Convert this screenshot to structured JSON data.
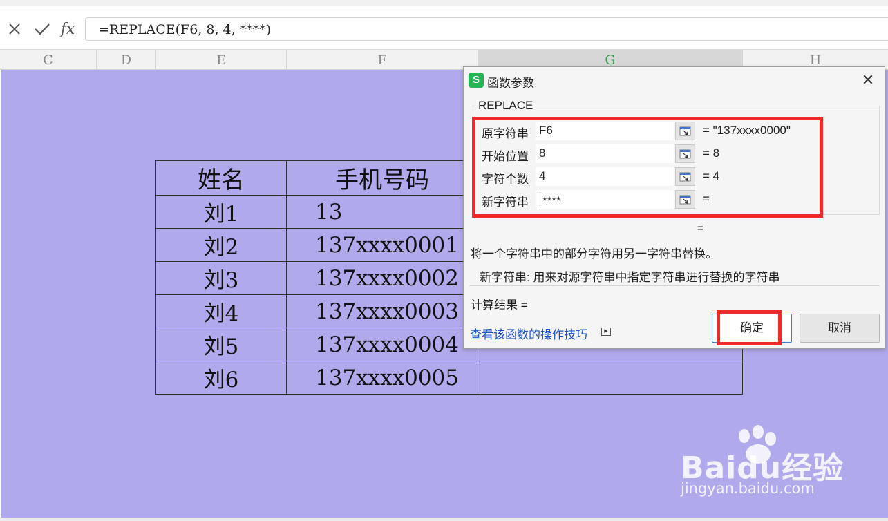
{
  "formula_bar": {
    "formula": "=REPLACE(F6, 8, 4, ****)",
    "cancel_icon": "close-icon",
    "confirm_icon": "check-icon",
    "fx_label": "fx"
  },
  "columns": [
    "C",
    "D",
    "E",
    "F",
    "G",
    "H"
  ],
  "selected_column": "G",
  "table": {
    "headers": [
      "姓名",
      "手机号码",
      ""
    ],
    "rows": [
      {
        "name": "刘1",
        "phone": "13",
        "result": ""
      },
      {
        "name": "刘2",
        "phone": "137xxxx0001",
        "result": ""
      },
      {
        "name": "刘3",
        "phone": "137xxxx0002",
        "result": ""
      },
      {
        "name": "刘4",
        "phone": "137xxxx0003",
        "result": ""
      },
      {
        "name": "刘5",
        "phone": "137xxxx0004",
        "result": ""
      },
      {
        "name": "刘6",
        "phone": "137xxxx0005",
        "result": ""
      }
    ]
  },
  "dialog": {
    "icon_letter": "S",
    "title": "函数参数",
    "function_name": "REPLACE",
    "args": [
      {
        "label": "原字符串",
        "value": "F6",
        "result": "= \"137xxxx0000\""
      },
      {
        "label": "开始位置",
        "value": "8",
        "result": "= 8"
      },
      {
        "label": "字符个数",
        "value": "4",
        "result": "= 4"
      },
      {
        "label": "新字符串",
        "value": "****",
        "result": "="
      }
    ],
    "formula_result_eq": "=",
    "description": "将一个字符串中的部分字符用另一字符串替换。",
    "arg_description": "新字符串:  用来对源字符串中指定字符串进行替换的字符串",
    "calc_result": "计算结果 =",
    "help_link": "查看该函数的操作技巧",
    "ok_label": "确定",
    "cancel_label": "取消"
  },
  "watermark": {
    "text": "Baidu经验",
    "url": "jingyan.baidu.com"
  },
  "colors": {
    "sheet_background": "#b0a9ec",
    "highlight_red": "#ee2a2a",
    "link_blue": "#1a52c9",
    "app_green": "#27b455"
  }
}
